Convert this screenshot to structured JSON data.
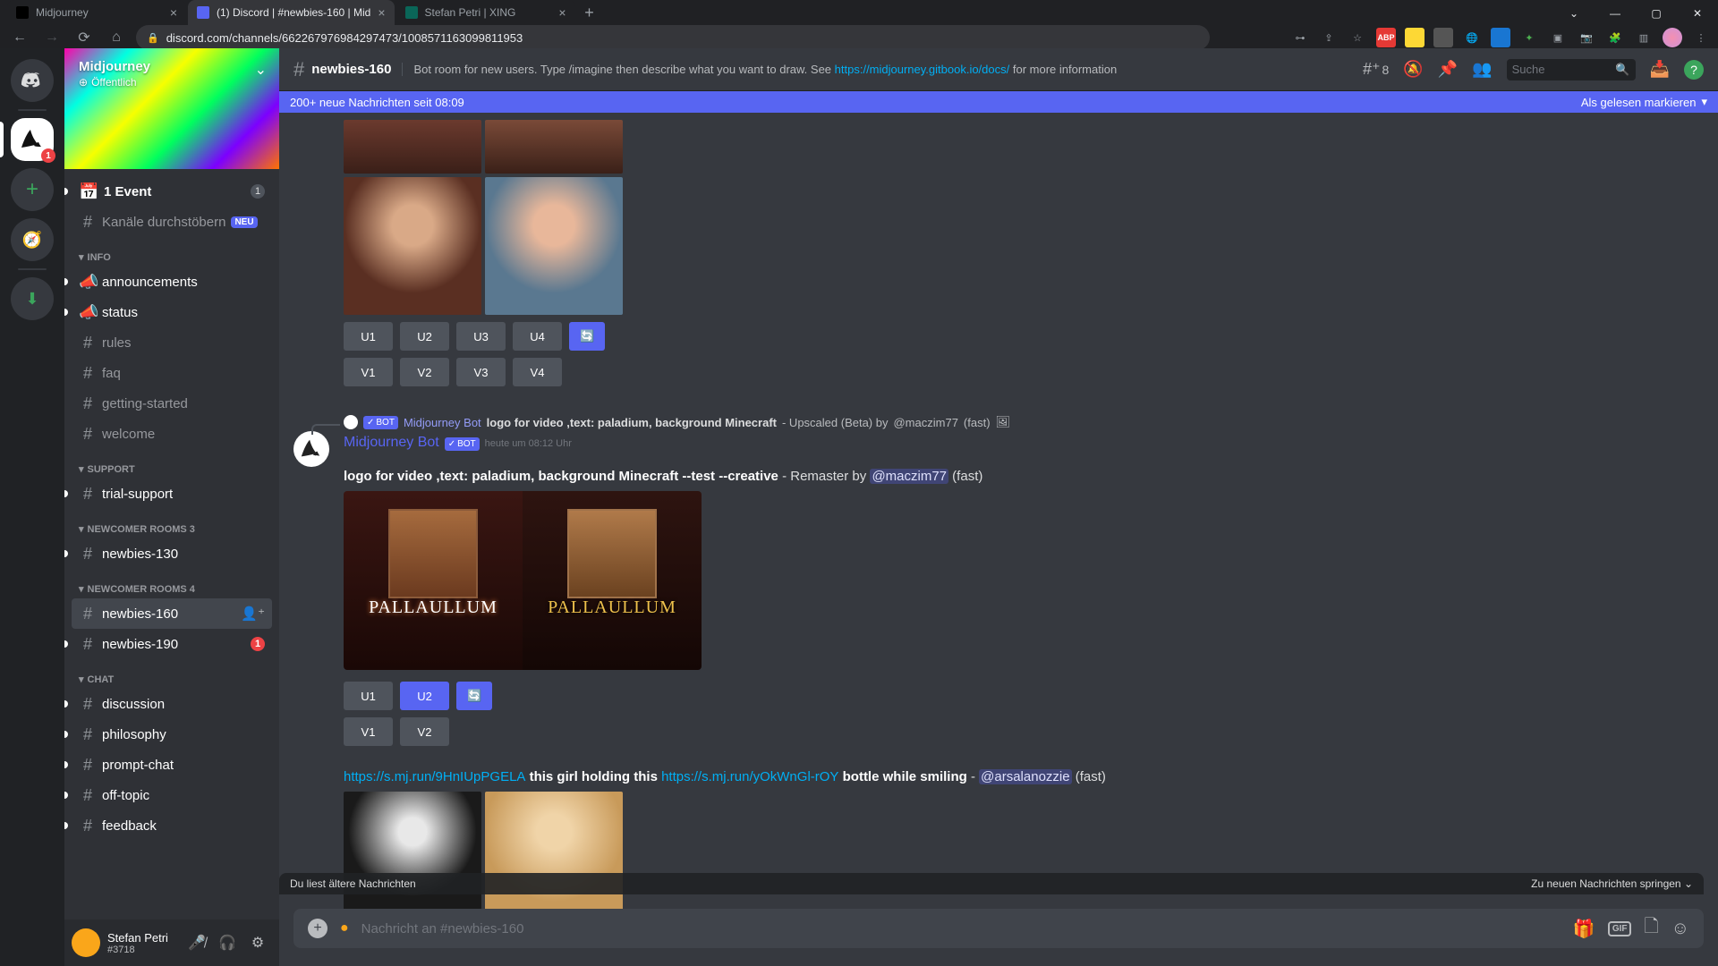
{
  "browser": {
    "tabs": [
      {
        "title": "Midjourney",
        "active": false,
        "favicon": "#000"
      },
      {
        "title": "(1) Discord | #newbies-160 | Mid",
        "active": true,
        "favicon": "#5865f2"
      },
      {
        "title": "Stefan Petri | XING",
        "active": false,
        "favicon": "#00695c"
      }
    ],
    "url": "discord.com/channels/662267976984297473/1008571163099811953",
    "window_controls": {
      "min": "—",
      "max": "▢",
      "close": "✕",
      "dropdown": "⌄"
    }
  },
  "guilds": {
    "home": "home",
    "items": [
      {
        "bg": "#fff",
        "badge": "1",
        "pill": true
      },
      {
        "bg": "#3ba55c",
        "label": "+"
      },
      {
        "bg": "#3ba55c",
        "label": "🧭"
      },
      {
        "bg": "#3ba55c",
        "label": "⬇"
      }
    ]
  },
  "server": {
    "name": "Midjourney",
    "public_label": "Öffentlich"
  },
  "channels": {
    "event_label": "1 Event",
    "event_count": "1",
    "browse_label": "Kanäle durchstöbern",
    "browse_badge": "NEU",
    "categories": [
      {
        "name": "INFO",
        "channels": [
          {
            "name": "announcements",
            "icon": "📣",
            "unread": true
          },
          {
            "name": "status",
            "icon": "📣",
            "unread": true
          },
          {
            "name": "rules",
            "icon": "#"
          },
          {
            "name": "faq",
            "icon": "#"
          },
          {
            "name": "getting-started",
            "icon": "#"
          },
          {
            "name": "welcome",
            "icon": "#"
          }
        ]
      },
      {
        "name": "SUPPORT",
        "channels": [
          {
            "name": "trial-support",
            "icon": "#",
            "unread": true
          }
        ]
      },
      {
        "name": "NEWCOMER ROOMS 3",
        "channels": [
          {
            "name": "newbies-130",
            "icon": "#",
            "unread": true
          }
        ]
      },
      {
        "name": "NEWCOMER ROOMS 4",
        "channels": [
          {
            "name": "newbies-160",
            "icon": "#",
            "selected": true,
            "addperson": true
          },
          {
            "name": "newbies-190",
            "icon": "#",
            "unread": true,
            "badge": "1"
          }
        ]
      },
      {
        "name": "CHAT",
        "channels": [
          {
            "name": "discussion",
            "icon": "#",
            "unread": true
          },
          {
            "name": "philosophy",
            "icon": "#",
            "unread": true
          },
          {
            "name": "prompt-chat",
            "icon": "#",
            "unread": true
          },
          {
            "name": "off-topic",
            "icon": "#",
            "unread": true
          },
          {
            "name": "feedback",
            "icon": "#",
            "unread": true
          }
        ]
      }
    ]
  },
  "user_panel": {
    "name": "Stefan Petri",
    "tag": "#3718"
  },
  "header": {
    "channel": "newbies-160",
    "topic_prefix": "Bot room for new users. Type /imagine then describe what you want to draw. See ",
    "topic_link": "https://midjourney.gitbook.io/docs/",
    "topic_suffix": " for more information",
    "threads_count": "8",
    "search_placeholder": "Suche"
  },
  "new_messages_bar": {
    "left": "200+ neue Nachrichten seit 08:09",
    "right": "Als gelesen markieren"
  },
  "messages": {
    "m1": {
      "btns_u": [
        "U1",
        "U2",
        "U3",
        "U4"
      ],
      "btns_v": [
        "V1",
        "V2",
        "V3",
        "V4"
      ]
    },
    "m2": {
      "reply_author": "Midjourney Bot",
      "reply_text": "logo for video ,text: paladium, background Minecraft",
      "reply_suffix": " - Upscaled (Beta) by ",
      "reply_mention": "@maczim77",
      "reply_fast": " (fast)",
      "author": "Midjourney Bot",
      "bot_label": "BOT",
      "time": "heute um 08:12 Uhr",
      "text_bold": "logo for video ,text: paladium, background Minecraft --test --creative",
      "text_mid": " - Remaster by ",
      "text_mention": "@maczim77",
      "text_fast": " (fast)",
      "pallad_left": "PALLAULLUM",
      "pallad_right": "PALLAULLUM",
      "btns_u": [
        "U1",
        "U2"
      ],
      "btns_v": [
        "V1",
        "V2"
      ]
    },
    "m3": {
      "link1": "https://s.mj.run/9HnIUpPGELA",
      "mid1": " this girl holding this ",
      "link2": "https://s.mj.run/yOkWnGl-rOY",
      "mid2": " bottle while smiling",
      "dash": " - ",
      "mention": "@arsalanozzie",
      "fast": " (fast)"
    }
  },
  "jump_bar": {
    "left": "Du liest ältere Nachrichten",
    "right": "Zu neuen Nachrichten springen"
  },
  "input": {
    "placeholder": "Nachricht an #newbies-160",
    "gif_label": "GIF"
  }
}
